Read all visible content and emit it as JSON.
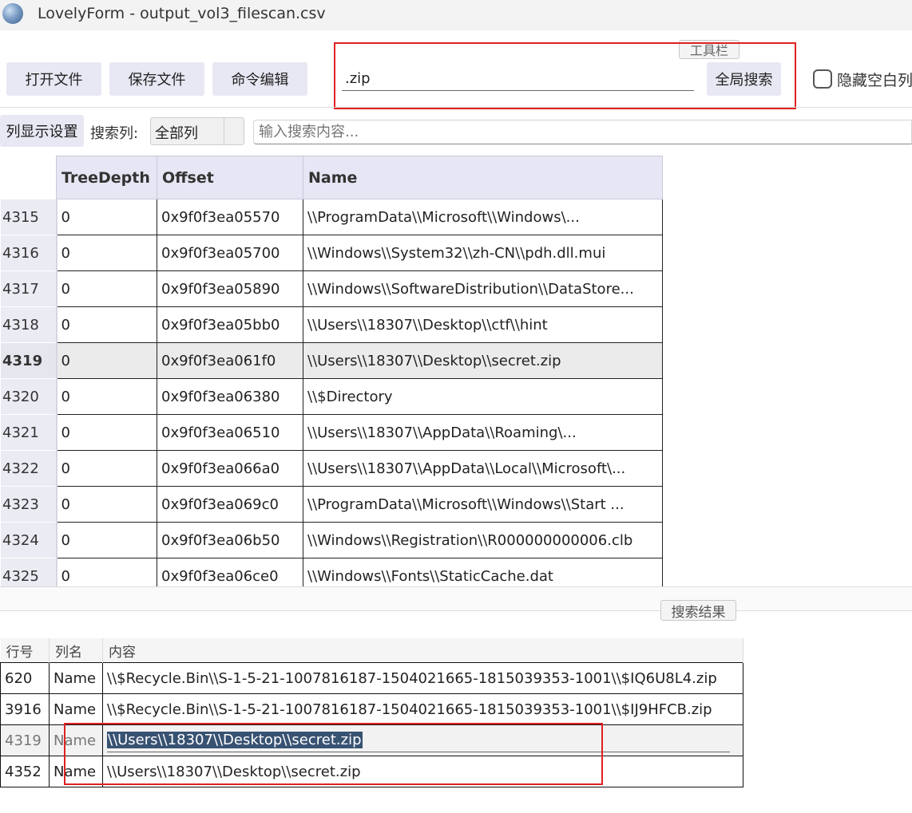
{
  "window": {
    "title": "LovelyForm - output_vol3_filescan.csv"
  },
  "toolbar": {
    "open_file": "打开文件",
    "save_file": "保存文件",
    "command_edit": "命令编辑",
    "search_value": ".zip",
    "global_search": "全局搜索",
    "groupbox_label": "工具栏",
    "hide_empty_columns": "隐藏空白列"
  },
  "filter": {
    "column_settings": "列显示设置",
    "search_column_label": "搜索列:",
    "search_column_value": "全部列",
    "search_placeholder": "输入搜索内容..."
  },
  "main_table": {
    "columns": [
      "TreeDepth",
      "Offset",
      "Name"
    ],
    "rows": [
      {
        "id": "4315",
        "depth": "0",
        "offset": "0x9f0f3ea05570",
        "name": "\\\\ProgramData\\\\Microsoft\\\\Windows\\..."
      },
      {
        "id": "4316",
        "depth": "0",
        "offset": "0x9f0f3ea05700",
        "name": "\\\\Windows\\\\System32\\\\zh-CN\\\\pdh.dll.mui"
      },
      {
        "id": "4317",
        "depth": "0",
        "offset": "0x9f0f3ea05890",
        "name": "\\\\Windows\\\\SoftwareDistribution\\\\DataStore..."
      },
      {
        "id": "4318",
        "depth": "0",
        "offset": "0x9f0f3ea05bb0",
        "name": "\\\\Users\\\\18307\\\\Desktop\\\\ctf\\\\hint"
      },
      {
        "id": "4319",
        "depth": "0",
        "offset": "0x9f0f3ea061f0",
        "name": "\\\\Users\\\\18307\\\\Desktop\\\\secret.zip"
      },
      {
        "id": "4320",
        "depth": "0",
        "offset": "0x9f0f3ea06380",
        "name": "\\\\$Directory"
      },
      {
        "id": "4321",
        "depth": "0",
        "offset": "0x9f0f3ea06510",
        "name": "\\\\Users\\\\18307\\\\AppData\\\\Roaming\\..."
      },
      {
        "id": "4322",
        "depth": "0",
        "offset": "0x9f0f3ea066a0",
        "name": "\\\\Users\\\\18307\\\\AppData\\\\Local\\\\Microsoft\\..."
      },
      {
        "id": "4323",
        "depth": "0",
        "offset": "0x9f0f3ea069c0",
        "name": "\\\\ProgramData\\\\Microsoft\\\\Windows\\\\Start ..."
      },
      {
        "id": "4324",
        "depth": "0",
        "offset": "0x9f0f3ea06b50",
        "name": "\\\\Windows\\\\Registration\\\\R000000000006.clb"
      },
      {
        "id": "4325",
        "depth": "0",
        "offset": "0x9f0f3ea06ce0",
        "name": "\\\\Windows\\\\Fonts\\\\StaticCache.dat"
      }
    ]
  },
  "results": {
    "groupbox_label": "搜索结果",
    "columns": [
      "行号",
      "列名",
      "内容"
    ],
    "rows": [
      {
        "line": "620",
        "column": "Name",
        "content": "\\\\$Recycle.Bin\\\\S-1-5-21-1007816187-1504021665-1815039353-1001\\\\$IQ6U8L4.zip"
      },
      {
        "line": "3916",
        "column": "Name",
        "content": "\\\\$Recycle.Bin\\\\S-1-5-21-1007816187-1504021665-1815039353-1001\\\\$IJ9HFCB.zip"
      },
      {
        "line": "4319",
        "column": "Name",
        "content": "\\\\Users\\\\18307\\\\Desktop\\\\secret.zip"
      },
      {
        "line": "4352",
        "column": "Name",
        "content": "\\\\Users\\\\18307\\\\Desktop\\\\secret.zip"
      }
    ]
  }
}
